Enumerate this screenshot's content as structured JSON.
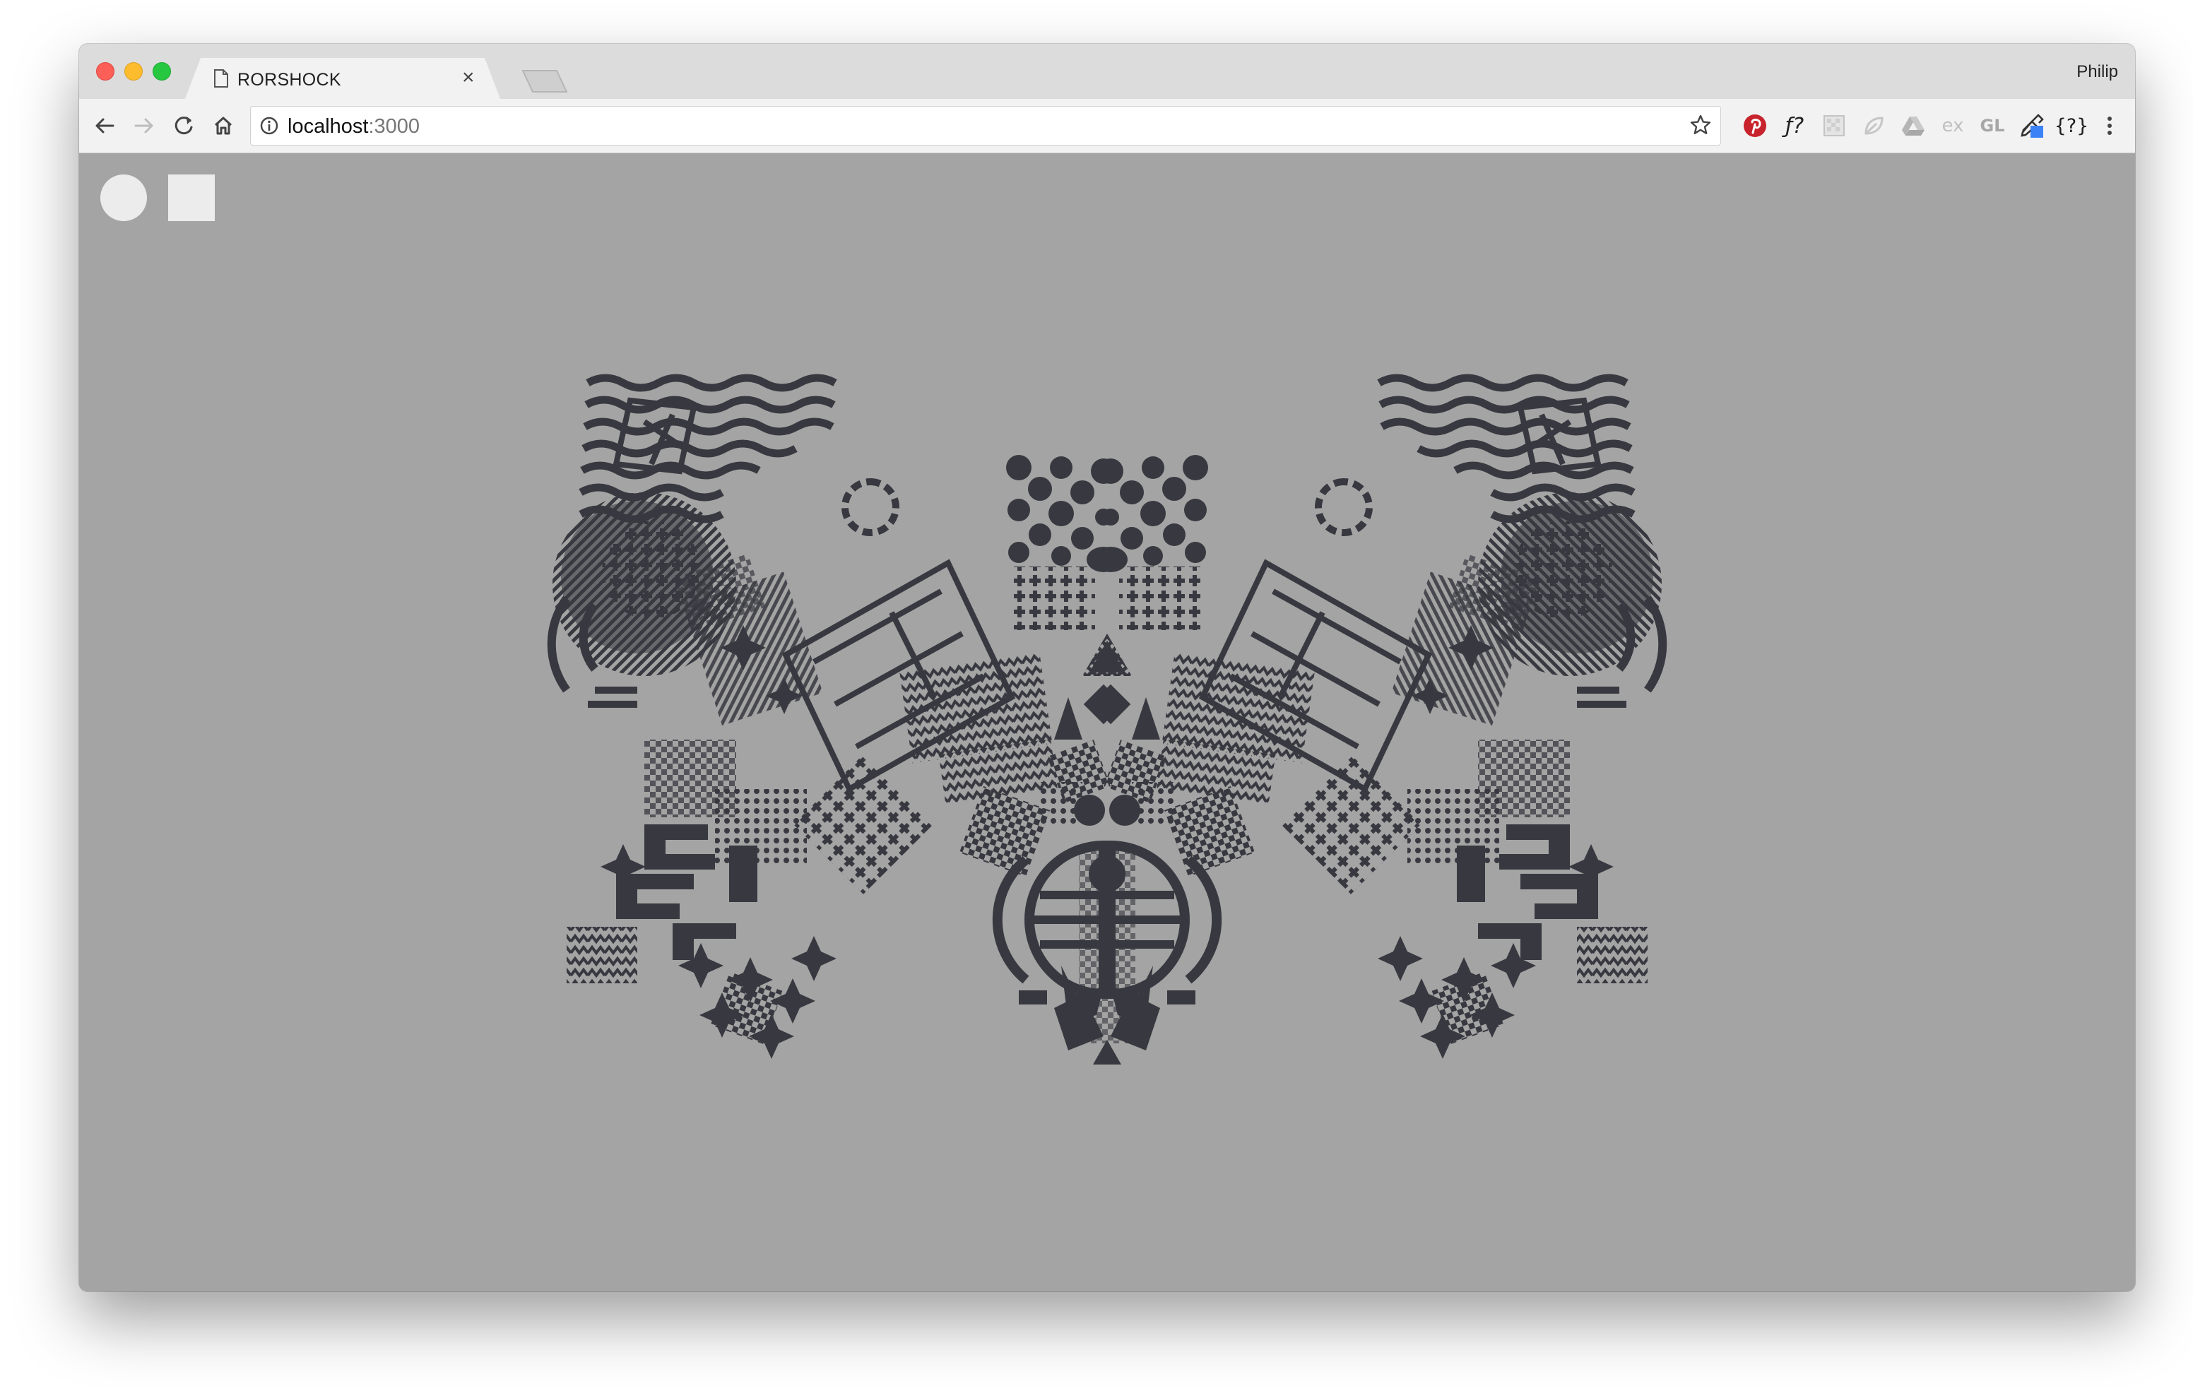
{
  "browser": {
    "tab": {
      "title": "RORSHOCK"
    },
    "profile": "Philip",
    "address": {
      "host": "localhost",
      "port": ":3000"
    },
    "extensions": [
      {
        "name": "pinterest-icon",
        "glyph": "P"
      },
      {
        "name": "font-identifier-icon",
        "glyph": "ƒ?"
      },
      {
        "name": "pattern-extension-icon",
        "glyph": ""
      },
      {
        "name": "leaf-extension-icon",
        "glyph": ""
      },
      {
        "name": "drive-extension-icon",
        "glyph": ""
      },
      {
        "name": "ex-extension-icon",
        "glyph": "ex"
      },
      {
        "name": "gl-extension-icon",
        "glyph": "GL"
      },
      {
        "name": "eyedropper-extension-icon",
        "glyph": ""
      },
      {
        "name": "json-extension-icon",
        "glyph": "{?}"
      }
    ]
  },
  "page": {
    "background_color": "#a4a4a4",
    "ink_color": "#383840",
    "controls": [
      {
        "name": "circle-shape-button",
        "shape": "circle"
      },
      {
        "name": "square-shape-button",
        "shape": "square"
      }
    ]
  }
}
